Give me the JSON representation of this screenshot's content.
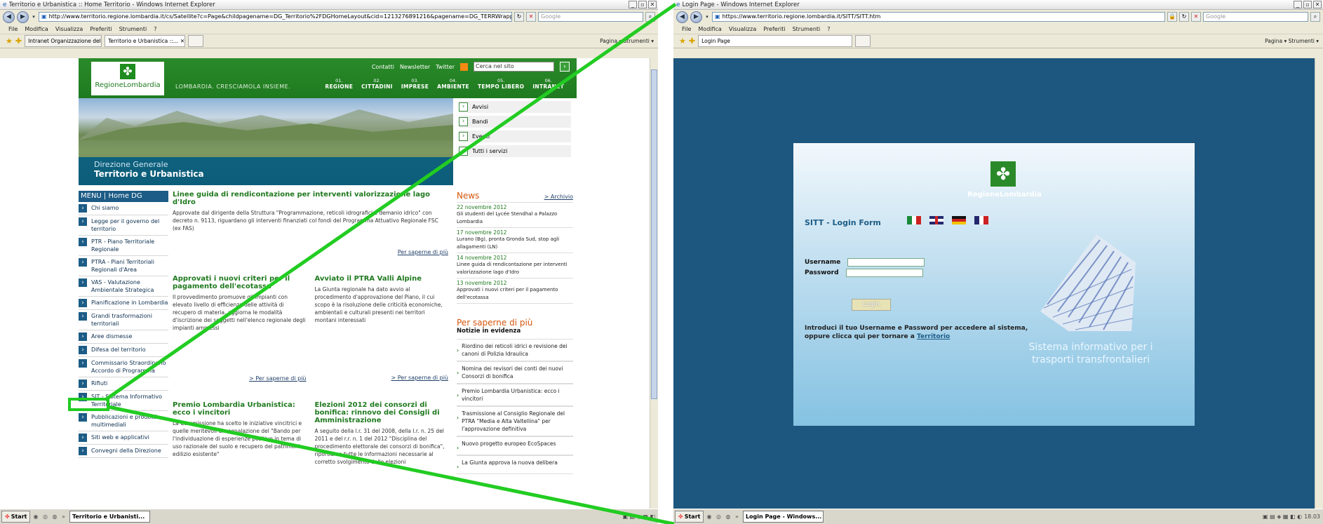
{
  "left_window": {
    "title": "Territorio e Urbanistica :: Home Territorio - Windows Internet Explorer",
    "address": "http://www.territorio.regione.lombardia.it/cs/Satellite?c=Page&childpagename=DG_Territorio%2FDGHomeLayout&cid=1213276891216&pagename=DG_TERRWrapper",
    "search_placeholder": "Google",
    "menu": [
      "File",
      "Modifica",
      "Visualizza",
      "Preferiti",
      "Strumenti",
      "?"
    ],
    "tabs": [
      "Intranet Organizzazione del ...",
      "Territorio e Urbanistica ::..."
    ],
    "tools": "Pagina ▾  Strumenti ▾",
    "taskbar": {
      "start": "Start",
      "item": "Territorio e Urbanisti..."
    }
  },
  "site": {
    "top_links": [
      "Contatti",
      "Newsletter",
      "Twitter"
    ],
    "search_value": "Cerca nel sito",
    "logo": "RegioneLombardia",
    "slogan": "LOMBARDIA. CRESCIAMOLA INSIEME.",
    "nav": [
      {
        "num": "01.",
        "label": "REGIONE"
      },
      {
        "num": "02.",
        "label": "CITTADINI"
      },
      {
        "num": "03.",
        "label": "IMPRESE"
      },
      {
        "num": "04.",
        "label": "AMBIENTE"
      },
      {
        "num": "05.",
        "label": "TEMPO LIBERO"
      },
      {
        "num": "06.",
        "label": "INTRANET"
      }
    ],
    "dg_line1": "Direzione Generale",
    "dg_line2": "Territorio e Urbanistica",
    "quick": [
      "Avvisi",
      "Bandi",
      "Eventi",
      "Tutti i servizi"
    ],
    "menu_head": "MENU | Home DG",
    "menu_items": [
      "Chi siamo",
      "Legge per il governo del territorio",
      "PTR - Piano Territoriale Regionale",
      "PTRA - Piani Territoriali Regionali d'Area",
      "VAS - Valutazione Ambientale Strategica",
      "Pianificazione in Lombardia",
      "Grandi trasformazioni territoriali",
      "Aree dismesse",
      "Difesa del territorio",
      "Commissario Straordinario Accordo di Programma",
      "Rifiuti",
      "SIT - Sistema Informativo Territoriale",
      "Pubblicazioni e prodotti multimediali",
      "Siti web e applicativi",
      "Convegni della Direzione"
    ],
    "lead": {
      "title": "Linee guida di rendicontazione per interventi valorizzazione lago d'Idro",
      "text": "Approvate dal dirigente della Struttura \"Programmazione, reticoli idrografici e demanio idrico\" con decreto n. 9113, riguardano gli interventi finanziati col fondi del Programma Attuativo Regionale FSC (ex FAS)",
      "more": "Per saperne di più"
    },
    "col1": {
      "title": "Approvati i nuovi criteri per il pagamento dell'ecotassa",
      "text": "Il provvedimento promuove gli impianti con elevato livello di efficienza delle attività di recupero di materia, aggiorna le modalità d'iscrizione dei soggetti nell'elenco regionale degli impianti ammessi",
      "more": "> Per saperne di più"
    },
    "col2": {
      "title": "Avviato il PTRA Valli Alpine",
      "text": "La Giunta regionale ha dato avvio al procedimento d'approvazione del Piano, il cui scopo è la risoluzione delle criticità economiche, ambientali e culturali presenti nei territori montani interessati",
      "more": "> Per saperne di più"
    },
    "col3": {
      "title": "Premio Lombardia Urbanistica: ecco i vincitori",
      "text": "La Commissione ha scelto le iniziative vincitrici e quelle meritevoli di segnalazione del \"Bando per l'individuazione di esperienze positive in tema di uso razionale del suolo e recupero del patrimonio edilizio esistente\""
    },
    "col4": {
      "title": "Elezioni 2012 dei consorzi di bonifica: rinnovo dei Consigli di Amministrazione",
      "text": "A seguito della l.r. 31 del 2008, della l.r. n. 25 del 2011 e del r.r. n. 1 del 2012 \"Disciplina del procedimento elettorale dei consorzi di bonifica\", riportiamo tutte le informazioni necessarie al corretto svolgimento delle elezioni"
    },
    "news_title": "News",
    "archive": "> Archivio",
    "news": [
      {
        "date": "22 novembre 2012",
        "text": "Gli studenti del Lycée Stendhal a Palazzo Lombardia"
      },
      {
        "date": "17 novembre 2012",
        "text": "Lurano (Bg), pronta Gronda Sud, stop agli allagamenti (LN)"
      },
      {
        "date": "14 novembre 2012",
        "text": "Linee guida di rendicontazione per interventi valorizzazione lago d'Idro"
      },
      {
        "date": "13 novembre 2012",
        "text": "Approvati i nuovi criteri per il pagamento dell'ecotassa"
      }
    ],
    "psp_title": "Per saperne di più",
    "psp_sub": "Notizie in evidenza",
    "psp_items": [
      "Riordino dei reticoli idrici e revisione dei canoni di Polizia Idraulica",
      "Nomina dei revisori dei conti dei nuovi Consorzi di bonifica",
      "Premio Lombardia Urbanistica: ecco i vincitori",
      "Trasmissione al Consiglio Regionale del PTRA \"Media e Alta Valtellina\" per l'approvazione definitiva",
      "Nuovo progetto europeo EcoSpaces",
      "La Giunta approva la nuova delibera"
    ]
  },
  "right_window": {
    "title": "Login Page - Windows Internet Explorer",
    "address": "https://www.territorio.regione.lombardia.it/SITT/SITT.htm",
    "search_placeholder": "Google",
    "menu": [
      "File",
      "Modifica",
      "Visualizza",
      "Preferiti",
      "Strumenti",
      "?"
    ],
    "tab": "Login Page",
    "tools": "Pagina ▾  Strumenti ▾",
    "taskbar": {
      "start": "Start",
      "item": "Login Page - Windows...",
      "clock": "18.03"
    }
  },
  "login": {
    "logo": "RegioneLombardia",
    "title": "SITT - Login Form",
    "username_label": "Username",
    "password_label": "Password",
    "button": "Login",
    "info_text": "Introduci il tuo Username e Password per accedere al sistema, oppure clicca qui per tornare a",
    "info_link": "Territorio",
    "caption": "Sistema informativo per i trasporti transfrontalieri"
  },
  "colors": {
    "highlight": "#22cc22",
    "site_green": "#1f7a1f",
    "login_bg": "#1d567e"
  }
}
